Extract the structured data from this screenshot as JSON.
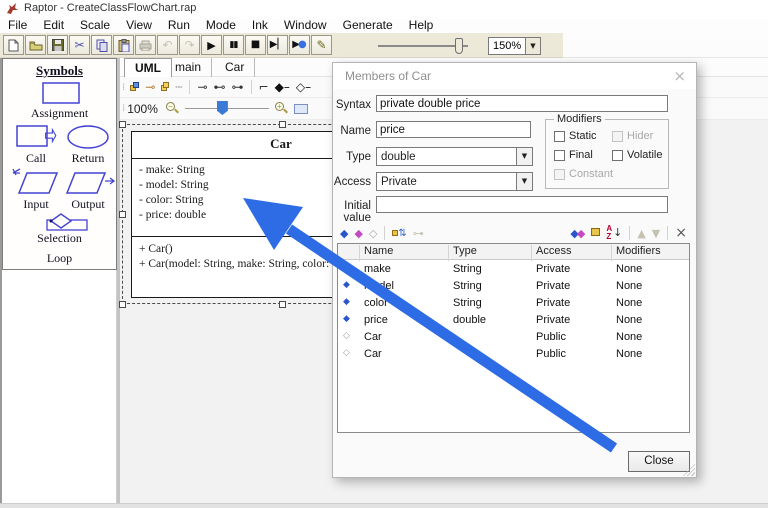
{
  "window": {
    "title": "Raptor - CreateClassFlowChart.rap"
  },
  "menu": {
    "items": [
      "File",
      "Edit",
      "Scale",
      "View",
      "Run",
      "Mode",
      "Ink",
      "Window",
      "Generate",
      "Help"
    ]
  },
  "toolbar": {
    "zoom_value": "150%",
    "icons": {
      "cut": "✂",
      "undo": "↶",
      "redo": "↷",
      "play": "▶",
      "pause": "▮▮",
      "stop": "■",
      "step": "▶▏",
      "pen": "✎"
    }
  },
  "sidebar": {
    "title": "Symbols",
    "labels": {
      "assignment": "Assignment",
      "call": "Call",
      "return": "Return",
      "input": "Input",
      "output": "Output",
      "selection": "Selection",
      "loop": "Loop"
    }
  },
  "tabs": [
    {
      "label": "UML"
    },
    {
      "label": "main"
    },
    {
      "label": "Car"
    }
  ],
  "canvas": {
    "zoom_label": "100%",
    "uml_class": {
      "name": "Car",
      "attributes": [
        "- make: String",
        "- model: String",
        "- color: String",
        "- price: double"
      ],
      "methods": [
        "+ Car()",
        "+ Car(model: String, make: String, color: Strin"
      ]
    }
  },
  "dialog": {
    "title": "Members of Car",
    "close_x": "×",
    "fields": {
      "syntax_label": "Syntax",
      "syntax_value": "private double price",
      "name_label": "Name",
      "name_value": "price",
      "type_label": "Type",
      "type_value": "double",
      "access_label": "Access",
      "access_value": "Private",
      "initial_label": "Initial value",
      "initial_value": ""
    },
    "modifiers": {
      "title": "Modifiers",
      "options": [
        {
          "label": "Static"
        },
        {
          "label": "Hider"
        },
        {
          "label": "Final"
        },
        {
          "label": "Volatile"
        },
        {
          "label": "Constant"
        }
      ]
    },
    "table": {
      "headers": [
        "Name",
        "Type",
        "Access",
        "Modifiers"
      ],
      "rows": [
        {
          "name": "make",
          "type": "String",
          "access": "Private",
          "modifiers": "None"
        },
        {
          "name": "model",
          "type": "String",
          "access": "Private",
          "modifiers": "None"
        },
        {
          "name": "color",
          "type": "String",
          "access": "Private",
          "modifiers": "None"
        },
        {
          "name": "price",
          "type": "double",
          "access": "Private",
          "modifiers": "None"
        },
        {
          "name": "Car",
          "type": "",
          "access": "Public",
          "modifiers": "None"
        },
        {
          "name": "Car",
          "type": "",
          "access": "Public",
          "modifiers": "None"
        }
      ]
    },
    "close_label": "Close"
  },
  "colors": {
    "annotation_arrow": "#2d6ce5",
    "shape_blue": "#4444d4",
    "toolbar_beige": "#ece9d8"
  }
}
